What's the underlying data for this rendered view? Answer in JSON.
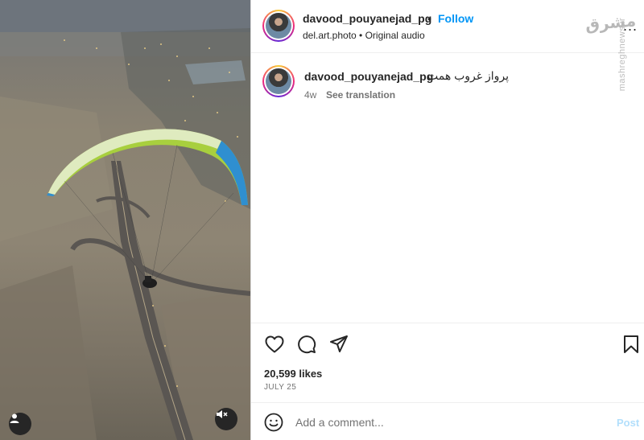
{
  "post": {
    "username": "davood_pouyanejad_pg",
    "separator": "•",
    "follow_label": "Follow",
    "audio_source": "del.art.photo • Original audio",
    "more_label": "...",
    "caption_text": "پرواز غروب همت",
    "time_ago": "4w",
    "see_translation_label": "See translation",
    "likes": "20,599 likes",
    "date": "JULY 25"
  },
  "watermark": {
    "logo_text": "مشرق",
    "url": "mashreghnews.ir"
  },
  "comment": {
    "placeholder": "Add a comment...",
    "post_label": "Post"
  },
  "icons": {
    "like": "heart-icon",
    "comment": "comment-icon",
    "share": "share-icon",
    "save": "bookmark-icon",
    "emoji": "emoji-icon",
    "user_tag": "user-icon",
    "mute": "muted-speaker-icon"
  },
  "colors": {
    "accent": "#0095f6",
    "post_disabled": "#b2dffc",
    "secondary_text": "#737373",
    "wing_green": "#a8cf3e",
    "wing_blue": "#2f8fd0"
  }
}
